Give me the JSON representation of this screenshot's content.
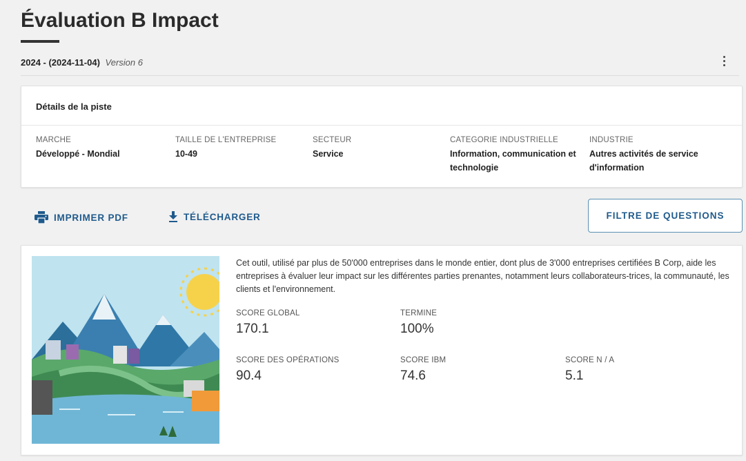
{
  "header": {
    "title": "Évaluation B Impact",
    "date_label": "2024 - (2024-11-04)",
    "version_label": "Version 6",
    "more_icon": "more-vert-icon"
  },
  "details": {
    "title": "Détails de la piste",
    "fields": [
      {
        "label": "MARCHE",
        "value": "Développé - Mondial"
      },
      {
        "label": "TAILLE DE L'ENTREPRISE",
        "value": "10-49"
      },
      {
        "label": "SECTEUR",
        "value": "Service"
      },
      {
        "label": "CATEGORIE INDUSTRIELLE",
        "value": "Information, communication et technologie"
      },
      {
        "label": "INDUSTRIE",
        "value": "Autres activités de service d'information"
      }
    ]
  },
  "actions": {
    "print_label": "IMPRIMER PDF",
    "print_icon": "printer-icon",
    "download_label": "TÉLÉCHARGER",
    "download_icon": "download-icon",
    "filter_label": "FILTRE DE QUESTIONS",
    "accent_color": "#1f5a8c"
  },
  "summary": {
    "description": "Cet outil, utilisé par plus de 50'000 entreprises dans le monde entier, dont plus de 3'000 entreprises certifiées B Corp, aide les entreprises à évaluer leur impact sur les différentes parties prenantes, notamment leurs collaborateurs-trices, la communauté, les clients et l'environnement.",
    "stats": {
      "global": {
        "label": "SCORE GLOBAL",
        "value": "170.1"
      },
      "termine": {
        "label": "TERMINE",
        "value": "100%"
      },
      "operations": {
        "label": "SCORE DES OPÉRATIONS",
        "value": "90.4"
      },
      "ibm": {
        "label": "SCORE IBM",
        "value": "74.6"
      },
      "na": {
        "label": "SCORE N / A",
        "value": "5.1"
      }
    }
  }
}
